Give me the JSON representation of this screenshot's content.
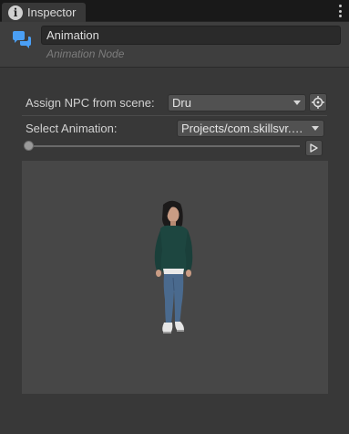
{
  "tab": {
    "title": "Inspector",
    "icon": "info-icon"
  },
  "header": {
    "name_value": "Animation",
    "subtitle": "Animation Node",
    "icon": "chat-bubbles-icon",
    "accent_color": "#4a9ff5"
  },
  "npc": {
    "label": "Assign NPC from scene:",
    "selected": "Dru",
    "picker_icon": "crosshair-icon"
  },
  "animation": {
    "label": "Select Animation:",
    "selected": "Projects/com.skillsvr.a...",
    "progress": 0.0,
    "play_icon": "play-icon"
  },
  "preview": {
    "background_color": "#474747",
    "character": "female-npc-figure"
  }
}
